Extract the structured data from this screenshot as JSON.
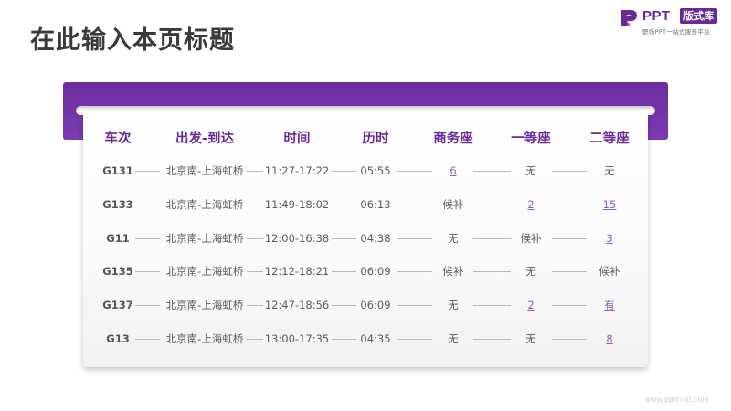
{
  "page_title": "在此输入本页标题",
  "logo": {
    "brand": "PPT",
    "badge": "版式库",
    "tagline": "职场PPT一站式服务平台"
  },
  "colors": {
    "accent": "#6a2a96",
    "link": "#8e5cc0"
  },
  "table": {
    "headers": [
      "车次",
      "出发-到达",
      "时间",
      "历时",
      "商务座",
      "一等座",
      "二等座"
    ],
    "rows": [
      {
        "train": "G131",
        "route": "北京南-上海虹桥",
        "time": "11:27-17:22",
        "duration": "05:55",
        "business": "6",
        "first": "无",
        "second": "无"
      },
      {
        "train": "G133",
        "route": "北京南-上海虹桥",
        "time": "11:49-18:02",
        "duration": "06:13",
        "business": "候补",
        "first": "2",
        "second": "15"
      },
      {
        "train": "G11",
        "route": "北京南-上海虹桥",
        "time": "12:00-16:38",
        "duration": "04:38",
        "business": "无",
        "first": "候补",
        "second": "3"
      },
      {
        "train": "G135",
        "route": "北京南-上海虹桥",
        "time": "12:12-18:21",
        "duration": "06:09",
        "business": "候补",
        "first": "无",
        "second": "候补"
      },
      {
        "train": "G137",
        "route": "北京南-上海虹桥",
        "time": "12:47-18:56",
        "duration": "06:09",
        "business": "无",
        "first": "2",
        "second": "有"
      },
      {
        "train": "G13",
        "route": "北京南-上海虹桥",
        "time": "13:00-17:35",
        "duration": "04:35",
        "business": "无",
        "first": "无",
        "second": "8"
      }
    ]
  },
  "watermark": "www.pptcool.com"
}
